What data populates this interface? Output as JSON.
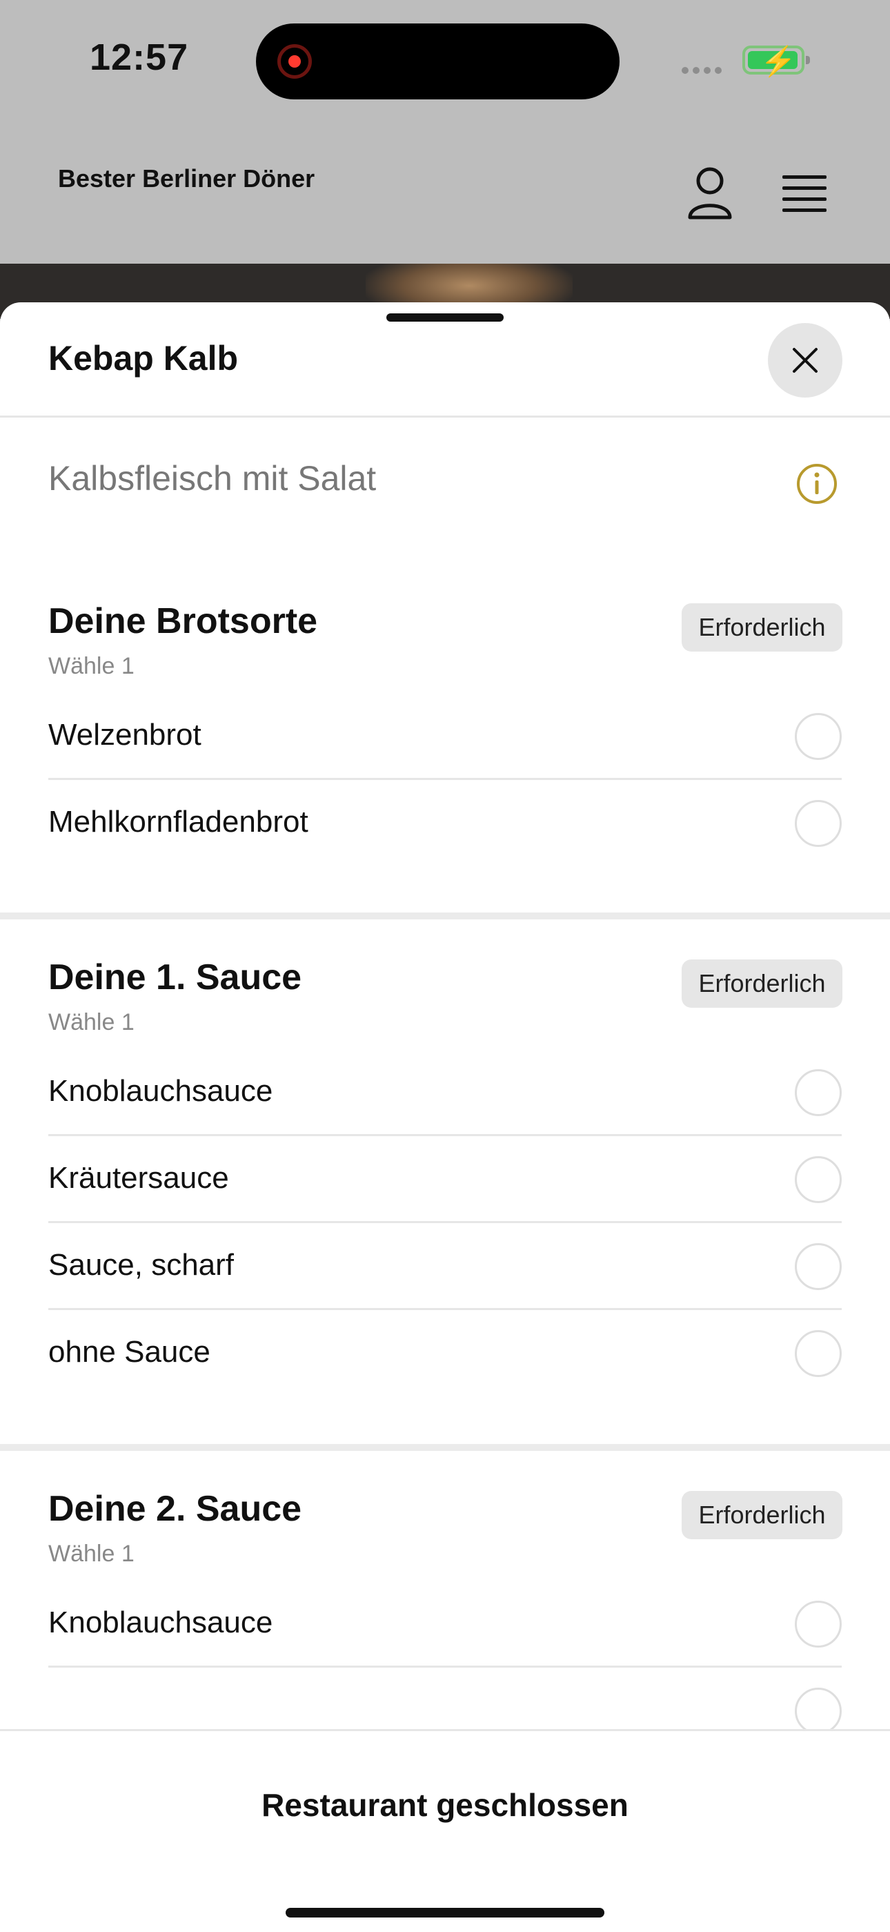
{
  "status_bar": {
    "time": "12:57"
  },
  "header": {
    "brand": "Bester Berliner Döner"
  },
  "sheet": {
    "title": "Kebap Kalb",
    "description": "Kalbsfleisch mit Salat",
    "sections": [
      {
        "title": "Deine Brotsorte",
        "subtitle": "Wähle 1",
        "badge": "Erforderlich",
        "options": [
          "Welzenbrot",
          "Mehlkornfladenbrot"
        ]
      },
      {
        "title": "Deine 1. Sauce",
        "subtitle": "Wähle 1",
        "badge": "Erforderlich",
        "options": [
          "Knoblauchsauce",
          "Kräutersauce",
          "Sauce, scharf",
          "ohne Sauce"
        ]
      },
      {
        "title": "Deine 2. Sauce",
        "subtitle": "Wähle 1",
        "badge": "Erforderlich",
        "options": [
          "Knoblauchsauce"
        ]
      }
    ]
  },
  "footer": {
    "label": "Restaurant geschlossen"
  },
  "colors": {
    "accent_info": "#b89a2e",
    "battery": "#34c759",
    "recording": "#ff3b30"
  }
}
